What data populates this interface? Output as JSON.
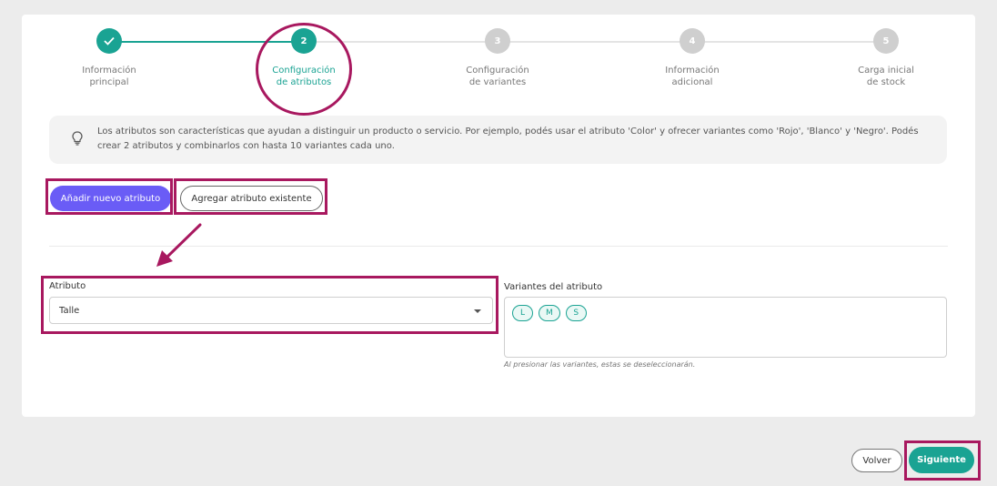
{
  "stepper": {
    "steps": [
      {
        "number": "1",
        "label_line1": "Información",
        "label_line2": "principal",
        "status": "done"
      },
      {
        "number": "2",
        "label_line1": "Configuración",
        "label_line2": "de atributos",
        "status": "active"
      },
      {
        "number": "3",
        "label_line1": "Configuración",
        "label_line2": "de variantes",
        "status": "pending"
      },
      {
        "number": "4",
        "label_line1": "Información",
        "label_line2": "adicional",
        "status": "pending"
      },
      {
        "number": "5",
        "label_line1": "Carga inicial",
        "label_line2": "de stock",
        "status": "pending"
      }
    ]
  },
  "info": {
    "icon": "lightbulb-icon",
    "text": "Los atributos son características que ayudan a distinguir un producto o servicio. Por ejemplo, podés usar el atributo 'Color' y ofrecer variantes como 'Rojo', 'Blanco' y 'Negro'. Podés crear 2 atributos y combinarlos con hasta 10 variantes cada uno."
  },
  "actions": {
    "add_new": "Añadir nuevo atributo",
    "add_existing": "Agregar atributo existente"
  },
  "form": {
    "attribute_label": "Atributo",
    "attribute_value": "Talle",
    "variants_label": "Variantes del atributo",
    "variants": [
      "L",
      "M",
      "S"
    ],
    "helper_text": "Al presionar las variantes, estas se deseleccionarán."
  },
  "footer": {
    "back": "Volver",
    "next": "Siguiente"
  },
  "colors": {
    "accent": "#1aa393",
    "primary_button": "#6a5cf6",
    "annotation": "#a8185f"
  }
}
